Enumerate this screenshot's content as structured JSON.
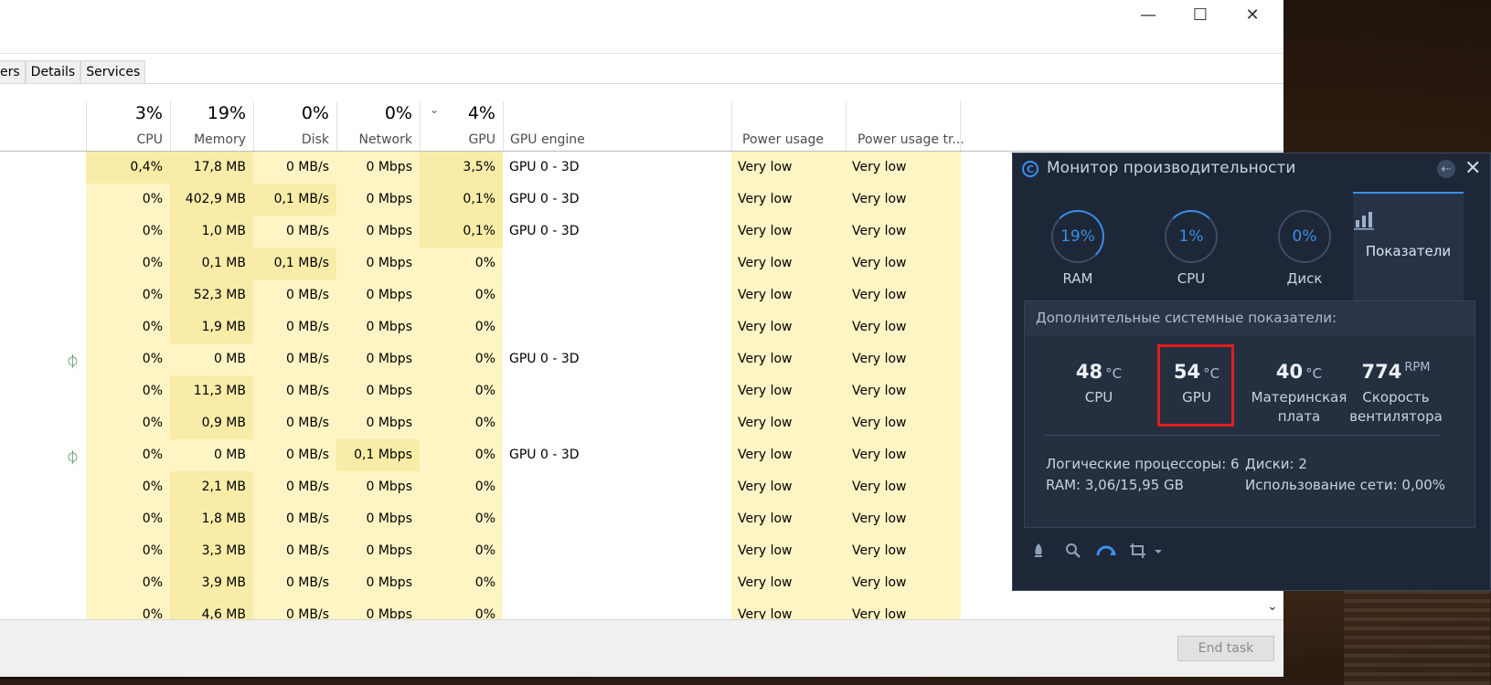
{
  "window": {
    "controls": {
      "minimize": "—",
      "maximize": "☐",
      "close": "✕"
    }
  },
  "tabs": [
    {
      "label": "ers"
    },
    {
      "label": "Details"
    },
    {
      "label": "Services"
    }
  ],
  "columns": {
    "cpu": {
      "pct": "3%",
      "label": "CPU"
    },
    "memory": {
      "pct": "19%",
      "label": "Memory"
    },
    "disk": {
      "pct": "0%",
      "label": "Disk"
    },
    "network": {
      "pct": "0%",
      "label": "Network"
    },
    "gpu": {
      "pct": "4%",
      "label": "GPU"
    },
    "gpu_engine": {
      "label": "GPU engine"
    },
    "power": {
      "label": "Power usage"
    },
    "power_trend": {
      "label": "Power usage tr..."
    }
  },
  "rows": [
    {
      "leaf": false,
      "cpu": "0,4%",
      "memory": "17,8 MB",
      "disk": "0 MB/s",
      "network": "0 Mbps",
      "gpu": "3,5%",
      "engine": "GPU 0 - 3D",
      "power": "Very low",
      "trend": "Very low"
    },
    {
      "leaf": false,
      "cpu": "0%",
      "memory": "402,9 MB",
      "disk": "0,1 MB/s",
      "network": "0 Mbps",
      "gpu": "0,1%",
      "engine": "GPU 0 - 3D",
      "power": "Very low",
      "trend": "Very low"
    },
    {
      "leaf": false,
      "cpu": "0%",
      "memory": "1,0 MB",
      "disk": "0 MB/s",
      "network": "0 Mbps",
      "gpu": "0,1%",
      "engine": "GPU 0 - 3D",
      "power": "Very low",
      "trend": "Very low"
    },
    {
      "leaf": false,
      "cpu": "0%",
      "memory": "0,1 MB",
      "disk": "0,1 MB/s",
      "network": "0 Mbps",
      "gpu": "0%",
      "engine": "",
      "power": "Very low",
      "trend": "Very low"
    },
    {
      "leaf": false,
      "cpu": "0%",
      "memory": "52,3 MB",
      "disk": "0 MB/s",
      "network": "0 Mbps",
      "gpu": "0%",
      "engine": "",
      "power": "Very low",
      "trend": "Very low"
    },
    {
      "leaf": false,
      "cpu": "0%",
      "memory": "1,9 MB",
      "disk": "0 MB/s",
      "network": "0 Mbps",
      "gpu": "0%",
      "engine": "",
      "power": "Very low",
      "trend": "Very low"
    },
    {
      "leaf": true,
      "cpu": "0%",
      "memory": "0 MB",
      "disk": "0 MB/s",
      "network": "0 Mbps",
      "gpu": "0%",
      "engine": "GPU 0 - 3D",
      "power": "Very low",
      "trend": "Very low"
    },
    {
      "leaf": false,
      "cpu": "0%",
      "memory": "11,3 MB",
      "disk": "0 MB/s",
      "network": "0 Mbps",
      "gpu": "0%",
      "engine": "",
      "power": "Very low",
      "trend": "Very low"
    },
    {
      "leaf": false,
      "cpu": "0%",
      "memory": "0,9 MB",
      "disk": "0 MB/s",
      "network": "0 Mbps",
      "gpu": "0%",
      "engine": "",
      "power": "Very low",
      "trend": "Very low"
    },
    {
      "leaf": true,
      "cpu": "0%",
      "memory": "0 MB",
      "disk": "0 MB/s",
      "network": "0,1 Mbps",
      "gpu": "0%",
      "engine": "GPU 0 - 3D",
      "power": "Very low",
      "trend": "Very low"
    },
    {
      "leaf": false,
      "cpu": "0%",
      "memory": "2,1 MB",
      "disk": "0 MB/s",
      "network": "0 Mbps",
      "gpu": "0%",
      "engine": "",
      "power": "Very low",
      "trend": "Very low"
    },
    {
      "leaf": false,
      "cpu": "0%",
      "memory": "1,8 MB",
      "disk": "0 MB/s",
      "network": "0 Mbps",
      "gpu": "0%",
      "engine": "",
      "power": "Very low",
      "trend": "Very low"
    },
    {
      "leaf": false,
      "cpu": "0%",
      "memory": "3,3 MB",
      "disk": "0 MB/s",
      "network": "0 Mbps",
      "gpu": "0%",
      "engine": "",
      "power": "Very low",
      "trend": "Very low"
    },
    {
      "leaf": false,
      "cpu": "0%",
      "memory": "3,9 MB",
      "disk": "0 MB/s",
      "network": "0 Mbps",
      "gpu": "0%",
      "engine": "",
      "power": "Very low",
      "trend": "Very low"
    },
    {
      "leaf": false,
      "cpu": "0%",
      "memory": "4,6 MB",
      "disk": "0 MB/s",
      "network": "0 Mbps",
      "gpu": "0%",
      "engine": "",
      "power": "Very low",
      "trend": "Very low"
    }
  ],
  "footer": {
    "end_task": "End task"
  },
  "monitor": {
    "title": "Монитор производительности",
    "gauges": [
      {
        "value": "19%",
        "name": "RAM"
      },
      {
        "value": "1%",
        "name": "CPU"
      },
      {
        "value": "0%",
        "name": "Диск"
      }
    ],
    "active_tab": {
      "name": "Показатели",
      "icon": "bar-chart-icon"
    },
    "panel_title": "Дополнительные системные показатели:",
    "metrics": [
      {
        "value": "48",
        "unit": "°C",
        "name": "CPU"
      },
      {
        "value": "54",
        "unit": "°C",
        "name": "GPU"
      },
      {
        "value": "40",
        "unit": "°C",
        "name": "Материнская плата"
      },
      {
        "value": "774",
        "unit": "RPM",
        "name": "Скорость вентилятора"
      }
    ],
    "info": {
      "logical_processors": "Логические процессоры: 6",
      "ram": "RAM: 3,06/15,95 GB",
      "disks": "Диски: 2",
      "network": "Использование сети: 0,00%"
    }
  }
}
